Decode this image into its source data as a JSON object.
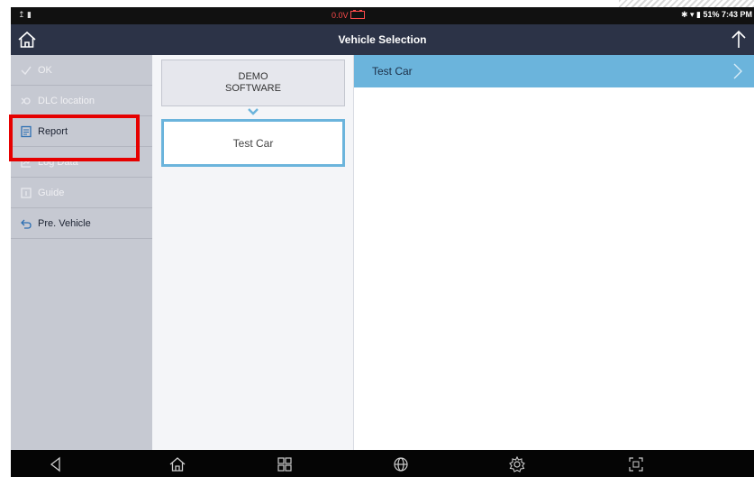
{
  "status_bar": {
    "left_icons": "↥ ▮",
    "voltage": "0.0V",
    "right_text": "✱ ▾ ▮ 51% 7:43 PM"
  },
  "title_bar": {
    "title": "Vehicle Selection"
  },
  "sidebar": {
    "items": [
      {
        "label": "OK",
        "icon": "check-icon",
        "enabled": false
      },
      {
        "label": "DLC location",
        "icon": "dlc-icon",
        "enabled": false
      },
      {
        "label": "Report",
        "icon": "report-icon",
        "enabled": true
      },
      {
        "label": "Log Data",
        "icon": "chart-icon",
        "enabled": false
      },
      {
        "label": "Guide",
        "icon": "guide-icon",
        "enabled": false
      },
      {
        "label": "Pre. Vehicle",
        "icon": "back-arrow-icon",
        "enabled": true
      }
    ]
  },
  "middle": {
    "demo_line1": "DEMO",
    "demo_line2": "SOFTWARE",
    "selected": "Test Car"
  },
  "list": {
    "items": [
      "Test Car"
    ]
  },
  "colors": {
    "accent": "#6bb4dc",
    "title_bg": "#2c3347",
    "sidebar_bg": "#c6c9d2",
    "highlight": "#e60000"
  }
}
